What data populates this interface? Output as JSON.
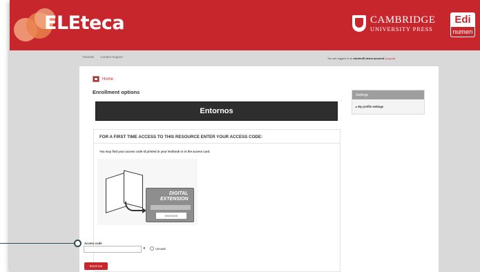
{
  "header": {
    "brand": "ELEteca",
    "publisher_line1": "Cambridge",
    "publisher_line2": "University Press",
    "partner_top": "Edi",
    "partner_bottom": "numen"
  },
  "topbar": {
    "links": [
      "Tutorials",
      "Contact Support"
    ],
    "login_prefix": "You are logged in as",
    "login_user": "student5 demo account",
    "login_logout": "(Logout)"
  },
  "main": {
    "breadcrumb_home": "Home",
    "title": "Enrollment options",
    "course_name": "Entornos",
    "access_heading": "FOR A FIRST TIME ACCESS TO THIS RESOURCE ENTER YOUR ACCESS CODE:",
    "access_help": "You may find your access code id printed in your textbook or in the access card.",
    "card_title_line1": "DIGITAL",
    "card_title_line2": "EXTENSION",
    "card_code": "XXXXXXX",
    "access_code_label": "Access code",
    "access_code_value": "",
    "unmask_label": "Unmask",
    "enroll_button": "Enrol me"
  },
  "settings": {
    "title": "Settings",
    "item": "My profile settings"
  },
  "colors": {
    "brand_red": "#c8262d",
    "banner_dark": "#2e2e2e",
    "callout": "#2b4a4e"
  }
}
